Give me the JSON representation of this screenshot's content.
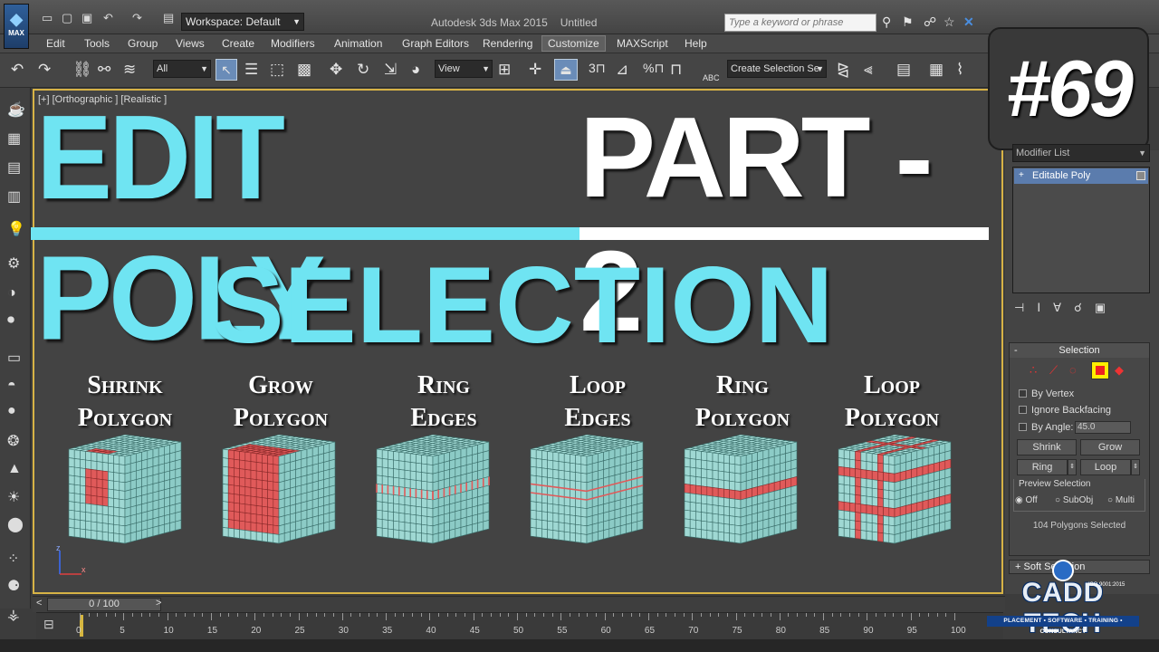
{
  "titlebar": {
    "logo_label": "MAX",
    "workspace": "Workspace: Default",
    "app_name": "Autodesk 3ds Max  2015",
    "doc_name": "Untitled",
    "search_placeholder": "Type a keyword or phrase"
  },
  "menu": [
    "Edit",
    "Tools",
    "Group",
    "Views",
    "Create",
    "Modifiers",
    "Animation",
    "Graph Editors",
    "Rendering",
    "Customize",
    "MAXScript",
    "Help"
  ],
  "menu_active": "Customize",
  "toolbar": {
    "filter": "All",
    "refcoord": "View",
    "selection_set": "Create Selection Se",
    "snap_3": "3",
    "snap_pct": "%",
    "abc": "ABC"
  },
  "viewport": {
    "label": "[+] [Orthographic ] [Realistic ]",
    "headline_cyan": "EDIT POLY",
    "headline_white": "PART - 2",
    "subheadline": "SELECTION",
    "episode": "#69",
    "gizmo_z": "z",
    "gizmo_x": "x"
  },
  "captions": [
    {
      "line1": "Shrink",
      "line2": "Polygon"
    },
    {
      "line1": "Grow",
      "line2": "Polygon"
    },
    {
      "line1": "Ring",
      "line2": "Edges"
    },
    {
      "line1": "Loop",
      "line2": "Edges"
    },
    {
      "line1": "Ring",
      "line2": "Polygon"
    },
    {
      "line1": "Loop",
      "line2": "Polygon"
    }
  ],
  "command_panel": {
    "modifier_list": "Modifier List",
    "stack_item": "Editable Poly",
    "selection_title": "Selection",
    "by_vertex": "By Vertex",
    "ignore_backfacing": "Ignore Backfacing",
    "by_angle": "By Angle:",
    "angle_value": "45.0",
    "shrink": "Shrink",
    "grow": "Grow",
    "ring": "Ring",
    "loop": "Loop",
    "preview_selection": "Preview Selection",
    "off": "Off",
    "subobj": "SubObj",
    "multi": "Multi",
    "polygons_selected": "104 Polygons Selected",
    "soft_selection": "Soft Selection"
  },
  "timeline": {
    "frame_display": "0 / 100",
    "ticks": [
      "0",
      "5",
      "10",
      "15",
      "20",
      "25",
      "30",
      "35",
      "40",
      "45",
      "50",
      "55",
      "60",
      "65",
      "70",
      "75",
      "80",
      "85",
      "90",
      "95",
      "100"
    ]
  },
  "branding": {
    "name": "CADD TECH",
    "iso": "ISO 9001:2015",
    "tagline": "PLACEMENT • SOFTWARE • TRAINING • CONSULTANCY"
  },
  "colors": {
    "cyan": "#6fe4f2",
    "cube_face": "#9fd8d3",
    "cube_line": "#3a6e6a",
    "selected": "#e05a5a",
    "viewport_border": "#d7b346"
  },
  "icons": [
    "undo-icon",
    "redo-icon",
    "link-icon",
    "unlink-icon",
    "bind-space-warp-icon",
    "select-icon",
    "select-by-name-icon",
    "rect-select-icon",
    "move-icon",
    "rotate-icon",
    "scale-icon",
    "snap-icon",
    "mirror-icon",
    "align-icon",
    "teapot-icon",
    "camera-icon",
    "light-icon",
    "sphere-icon",
    "cone-icon",
    "sun-icon"
  ]
}
